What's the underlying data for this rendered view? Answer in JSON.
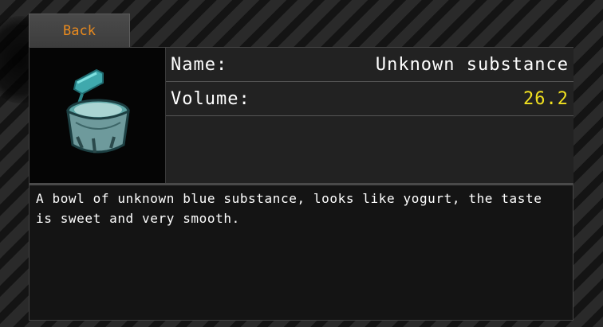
{
  "back_button": {
    "label": "Back"
  },
  "item": {
    "icon": "blue-yogurt-bowl-icon",
    "name_label": "Name:",
    "name_value": "Unknown substance",
    "volume_label": "Volume:",
    "volume_value": "26.2",
    "description": "A bowl of unknown blue substance, looks like yogurt, the taste is sweet and very smooth."
  },
  "colors": {
    "accent_orange": "#e98a1e",
    "value_yellow": "#f0e020",
    "icon_teal": "#4fb8b8"
  }
}
